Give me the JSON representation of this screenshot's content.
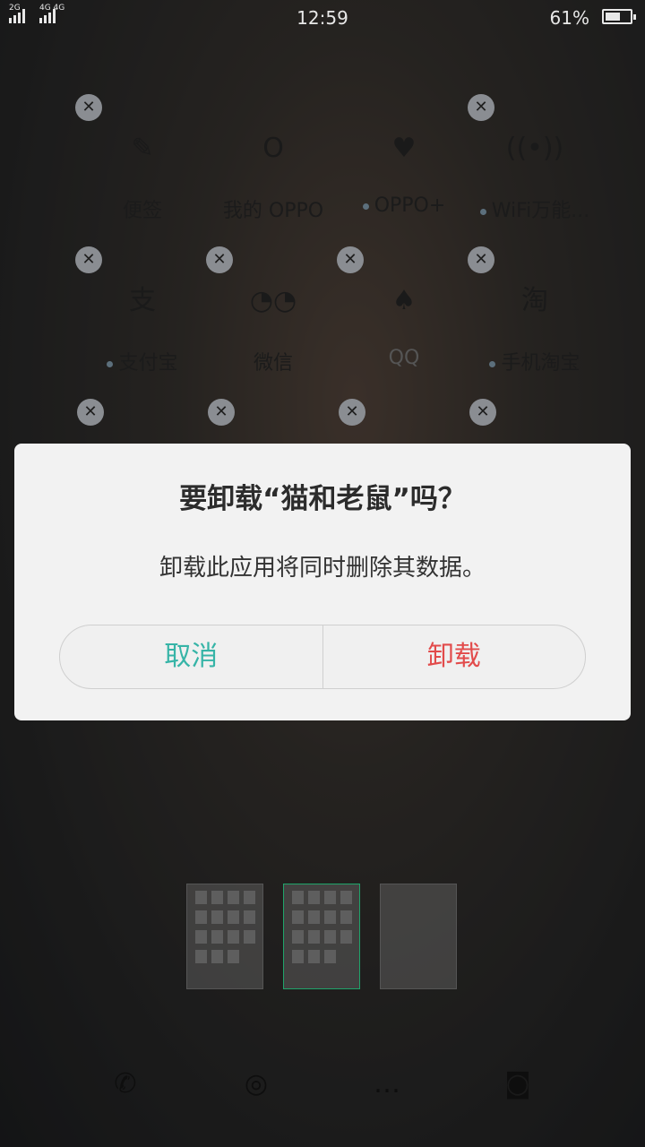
{
  "status_bar": {
    "sim1_label": "2G",
    "sim2_label": "4G 4G",
    "time": "12:59",
    "battery_percent": "61%",
    "battery_level": 0.61
  },
  "apps": [
    {
      "name": "便签",
      "icon": "note-edit-icon",
      "glyph": "✎",
      "dot": false,
      "removable": true
    },
    {
      "name": "我的 OPPO",
      "icon": "oppo-icon",
      "glyph": "O",
      "dot": false,
      "removable": false
    },
    {
      "name": "OPPO+",
      "icon": "heart-icon",
      "glyph": "♥",
      "dot": true,
      "removable": false
    },
    {
      "name": "WiFi万能...",
      "icon": "wifi-key-icon",
      "glyph": "((•))",
      "dot": true,
      "removable": true
    },
    {
      "name": "支付宝",
      "icon": "alipay-icon",
      "glyph": "支",
      "dot": true,
      "removable": true
    },
    {
      "name": "微信",
      "icon": "wechat-icon",
      "glyph": "◔◔",
      "dot": false,
      "removable": true
    },
    {
      "name": "QQ",
      "icon": "qq-penguin-icon",
      "glyph": "♠",
      "dot": false,
      "removable": true
    },
    {
      "name": "手机淘宝",
      "icon": "taobao-icon",
      "glyph": "淘",
      "dot": true,
      "removable": true
    }
  ],
  "dialog": {
    "title": "要卸载“猫和老鼠”吗？",
    "message": "卸载此应用将同时删除其数据。",
    "cancel_label": "取消",
    "uninstall_label": "卸载",
    "cancel_color": "#36b4a7",
    "uninstall_color": "#e24b4b"
  },
  "pages": {
    "count": 3,
    "active_index": 1
  },
  "dock": [
    {
      "icon": "phone-icon",
      "glyph": "✆"
    },
    {
      "icon": "browser-icon",
      "glyph": "◎"
    },
    {
      "icon": "message-icon",
      "glyph": "…"
    },
    {
      "icon": "camera-icon",
      "glyph": "◙"
    }
  ]
}
